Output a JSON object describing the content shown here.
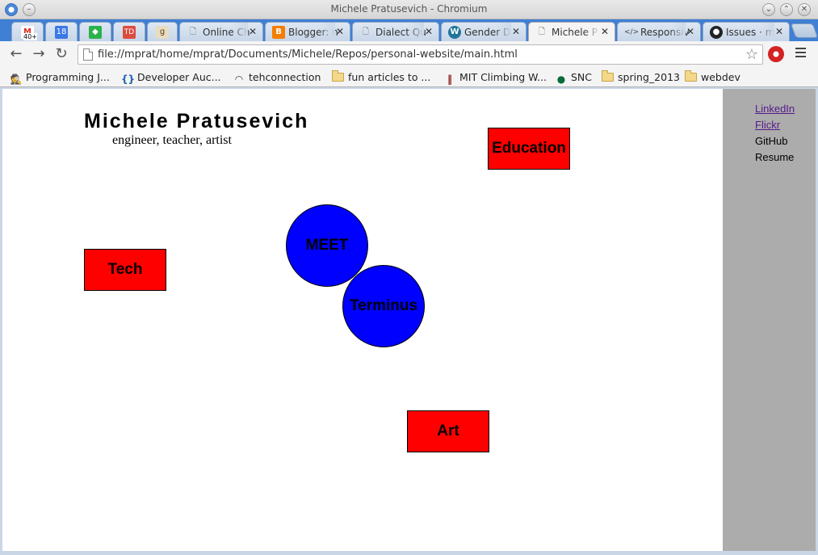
{
  "window": {
    "title": "Michele Pratusevich - Chromium"
  },
  "tabs": [
    {
      "label": "",
      "icon": "gmail-icon",
      "badge": "40+",
      "color": "#d93025"
    },
    {
      "label": "",
      "icon": "calendar-icon",
      "badge": "18",
      "color": "#3b78e7"
    },
    {
      "label": "",
      "icon": "feedly-icon",
      "color": "#2bb24c"
    },
    {
      "label": "",
      "icon": "todoist-icon",
      "badge": "TD",
      "color": "#db4c3f"
    },
    {
      "label": "",
      "icon": "goodreads-icon",
      "badge": "g",
      "color": "#e8dcc2"
    },
    {
      "label": "Online Ch",
      "icon": "page-icon"
    },
    {
      "label": "Blogger: n",
      "icon": "blogger-icon",
      "color": "#f57d00"
    },
    {
      "label": "Dialect Qu",
      "icon": "page-icon"
    },
    {
      "label": "Gender D",
      "icon": "wordpress-icon",
      "color": "#21759b"
    },
    {
      "label": "Michele P",
      "icon": "page-icon",
      "active": true
    },
    {
      "label": "Responsiv",
      "icon": "code-icon"
    },
    {
      "label": "Issues · m",
      "icon": "github-icon",
      "color": "#222222"
    }
  ],
  "toolbar": {
    "url": "file://mprat/home/mprat/Documents/Michele/Repos/personal-website/main.html"
  },
  "bookmarks": [
    {
      "label": "Programming J...",
      "icon": "spy-icon"
    },
    {
      "label": "Developer Auc...",
      "icon": "braces-icon"
    },
    {
      "label": "tehconnection",
      "icon": "wifi-icon"
    },
    {
      "label": "fun articles to ...",
      "icon": "folder-icon"
    },
    {
      "label": "MIT Climbing W...",
      "icon": "mit-icon"
    },
    {
      "label": "SNC",
      "icon": "snc-icon"
    },
    {
      "label": "spring_2013",
      "icon": "folder-icon"
    },
    {
      "label": "webdev",
      "icon": "folder-icon"
    }
  ],
  "page": {
    "heading": "Michele Pratusevich",
    "subtitle": "engineer, teacher, artist",
    "boxes": {
      "education": "Education",
      "tech": "Tech",
      "art": "Art"
    },
    "circles": {
      "meet": "MEET",
      "terminus": "Terminus"
    },
    "sidebar": {
      "linkedin": "LinkedIn",
      "flickr": "Flickr",
      "github": "GitHub",
      "resume": "Resume"
    },
    "colors": {
      "box": "#ff0000",
      "circle": "#0000ff",
      "sidebar": "#acacac"
    }
  }
}
